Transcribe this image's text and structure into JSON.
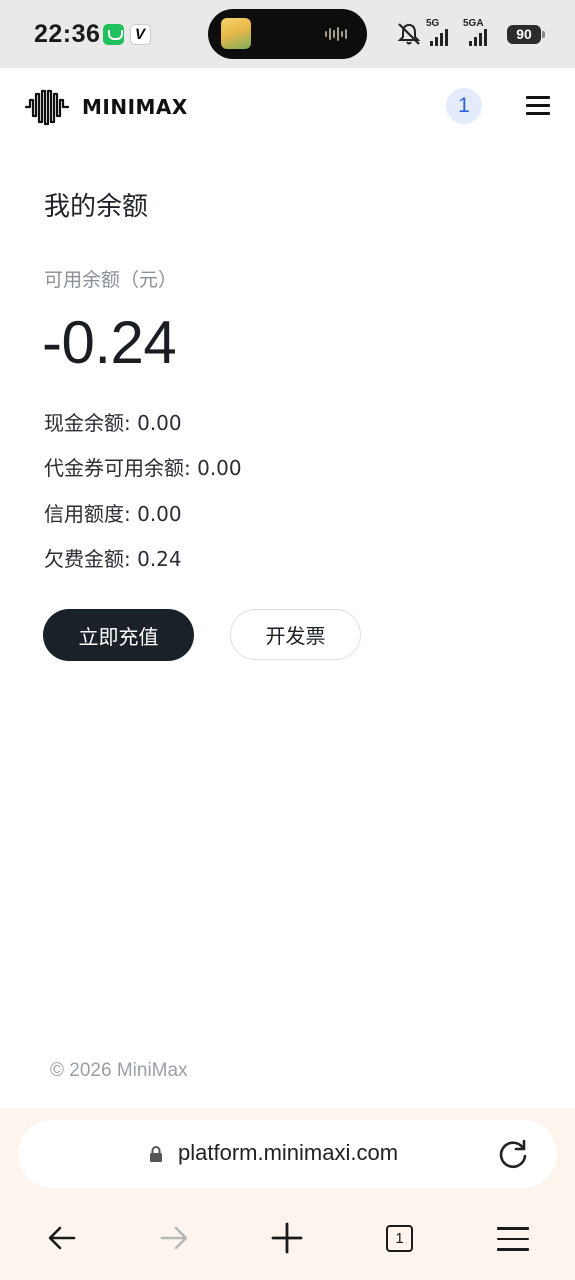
{
  "status_bar": {
    "time": "22:36",
    "network_1": "5G",
    "network_2": "5GA",
    "battery": "90",
    "icons": [
      "app-green-icon",
      "app-v-icon",
      "mute-icon",
      "signal-icon",
      "battery-icon"
    ]
  },
  "header": {
    "logo_text": "MINIMAX",
    "notification_count": "1",
    "icons": [
      "logo-waveform-icon",
      "hamburger-menu-icon"
    ]
  },
  "main": {
    "title": "我的余额",
    "available_label": "可用余额（元）",
    "available_value": "-0.24",
    "details": [
      {
        "label": "现金余额",
        "value": "0.00",
        "text": "现金余额: 0.00"
      },
      {
        "label": "代金券可用余额",
        "value": "0.00",
        "text": "代金券可用余额: 0.00"
      },
      {
        "label": "信用额度",
        "value": "0.00",
        "text": "信用额度: 0.00"
      },
      {
        "label": "欠费金额",
        "value": "0.24",
        "text": "欠费金额: 0.24"
      }
    ],
    "recharge_button": "立即充值",
    "invoice_button": "开发票"
  },
  "footer": {
    "copyright": "© 2026 MiniMax"
  },
  "browser": {
    "url": "platform.minimaxi.com",
    "tab_count": "1",
    "icons": [
      "lock-icon",
      "reload-icon",
      "back-arrow-icon",
      "forward-arrow-icon",
      "new-tab-plus-icon",
      "tabs-icon",
      "browser-menu-icon"
    ]
  },
  "colors": {
    "primary_button": "#1b2129",
    "badge_bg": "#e4ecfb",
    "badge_text": "#2f62d9",
    "browser_bar": "#fcf4ed"
  }
}
